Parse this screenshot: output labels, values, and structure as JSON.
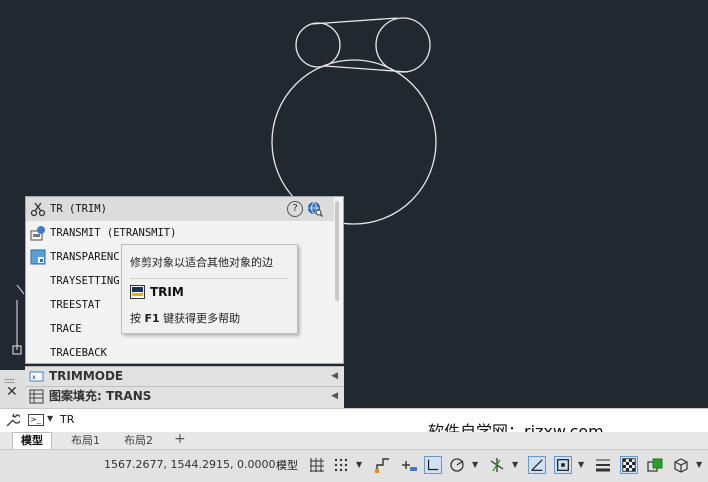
{
  "autocomplete": {
    "items": [
      {
        "label": "TR (TRIM)",
        "icon": "scissors-icon",
        "selected": true
      },
      {
        "label": "TRANSMIT (ETRANSMIT)",
        "icon": "etransmit-icon"
      },
      {
        "label": "TRANSPARENC",
        "icon": "transparency-icon"
      },
      {
        "label": "TRAYSETTING"
      },
      {
        "label": "TREESTAT"
      },
      {
        "label": "TRACE"
      },
      {
        "label": "TRACEBACK"
      }
    ],
    "help_glyph": "?"
  },
  "tooltip": {
    "description": "修剪对象以适合其他对象的边",
    "command": "TRIM",
    "help_prefix": "按",
    "help_key": "F1",
    "help_suffix": "键获得更多帮助"
  },
  "history": {
    "row1": "TRIMMODE",
    "row2": "图案填充: TRANS",
    "grip_dots": "::::::",
    "close_glyph": "✕"
  },
  "command_line": {
    "prompt_glyph": ">_",
    "value": "TR"
  },
  "watermark": "软件自学网：rjzxw.com",
  "layout_tabs": [
    {
      "label": "模型",
      "active": true
    },
    {
      "label": "布局1"
    },
    {
      "label": "布局2"
    }
  ],
  "add_tab_glyph": "+",
  "status_bar": {
    "coordinates": "1567.2677, 1544.2915, 0.0000",
    "model_label": "模型",
    "dropdown_glyph": "▼"
  },
  "colors": {
    "canvas": "#212830",
    "panel": "#f3f3f3",
    "selected_row": "#dcdcdc",
    "drawing_lines": "#e6e6e6",
    "status_active": "#cfe2f5"
  }
}
